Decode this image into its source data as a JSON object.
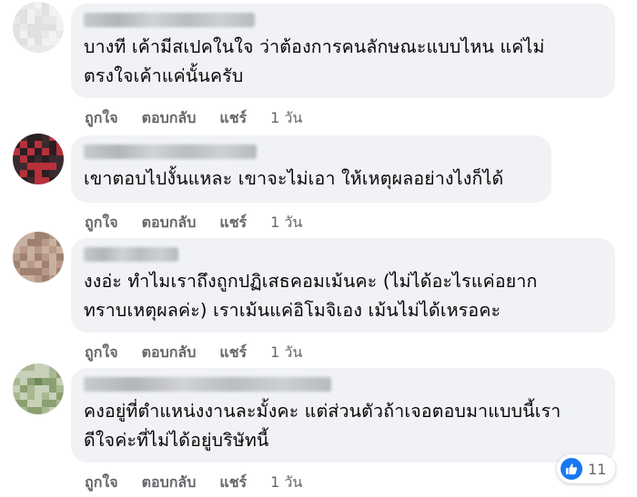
{
  "comments": [
    {
      "text": "บางที เค้ามีสเปคในใจ ว่าต้องการคนลักษณะแบบไหน แค่ไม่\nตรงใจเค้าแค่นั้นครับ",
      "actions": {
        "like": "ถูกใจ",
        "reply": "ตอบกลับ",
        "share": "แชร์",
        "time": "1 วัน"
      }
    },
    {
      "text": "เขาตอบไปงั้นแหละ เขาจะไม่เอา ให้เหตุผลอย่างไงก็ได้",
      "actions": {
        "like": "ถูกใจ",
        "reply": "ตอบกลับ",
        "share": "แชร์",
        "time": "1 วัน"
      }
    },
    {
      "text": "งงอ่ะ ทำไมเราถึงถูกปฏิเสธคอมเม้นคะ (ไม่ได้อะไรแค่อยาก\nทราบเหตุผลค่ะ) เราเม้นแค่อิโมจิเอง เม้นไม่ได้เหรอคะ",
      "actions": {
        "like": "ถูกใจ",
        "reply": "ตอบกลับ",
        "share": "แชร์",
        "time": "1 วัน"
      }
    },
    {
      "text": "คงอยู่ที่ตำแหน่งงานละมั้งคะ แต่ส่วนตัวถ้าเจอตอบมาแบบนี้เรา\nดีใจค่ะที่ไม่ได้อยู่บริษัทนี้",
      "actions": {
        "like": "ถูกใจ",
        "reply": "ตอบกลับ",
        "share": "แชร์",
        "time": "1 วัน"
      }
    }
  ],
  "reactions": {
    "icon": "thumbs-up-icon",
    "count": "11",
    "color": "#1877f2"
  }
}
